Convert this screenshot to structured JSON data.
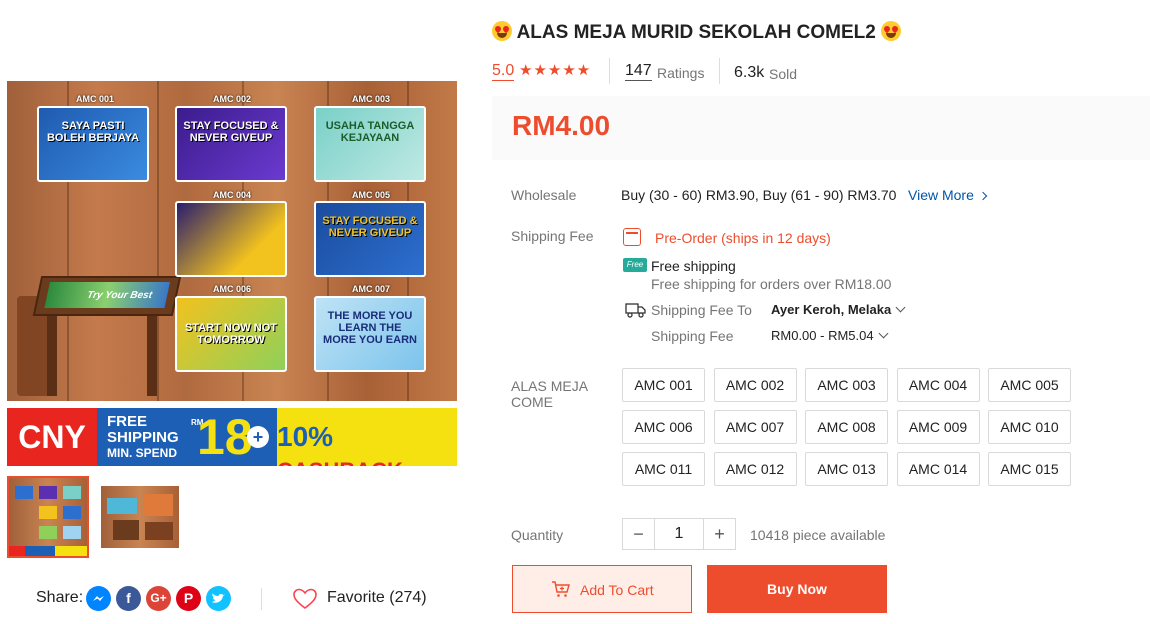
{
  "product": {
    "title": "ALAS MEJA MURID SEKOLAH COMEL2",
    "rating": "5.0",
    "stars": "★★★★★",
    "ratings_count": "147",
    "ratings_label": "Ratings",
    "sold_count": "6.3k",
    "sold_label": "Sold",
    "price": "RM4.00"
  },
  "gallery": {
    "mat_codes": [
      "AMC 001",
      "AMC 002",
      "AMC 003",
      "AMC 004",
      "AMC 005",
      "AMC 006",
      "AMC 007"
    ],
    "mat_texts": [
      "SAYA PASTI BOLEH BERJAYA",
      "STAY FOCUSED & NEVER GIVEUP",
      "USAHA TANGGA KEJAYAAN",
      "",
      "STAY FOCUSED & NEVER GIVEUP",
      "START NOW NOT TOMORROW",
      "THE MORE YOU LEARN THE MORE YOU EARN"
    ],
    "desk_mat_text": "Try Your Best",
    "banner": {
      "cny": "CNY",
      "free_line1": "FREE",
      "free_line2": "SHIPPING",
      "free_line3": "MIN. SPEND",
      "rm": "RM",
      "amount": "18",
      "plus": "+",
      "cashback_pct": "10%",
      "cashback": "CASHBACK"
    }
  },
  "share": {
    "label": "Share:",
    "favorite": "Favorite (274)"
  },
  "wholesale": {
    "label": "Wholesale",
    "text": "Buy (30 - 60) RM3.90, Buy (61 - 90) RM3.70",
    "view_more": "View More"
  },
  "shipping": {
    "label": "Shipping Fee",
    "preorder": "Pre-Order (ships in 12 days)",
    "free_badge": "Free",
    "free_title": "Free shipping",
    "free_sub": "Free shipping for orders over RM18.00",
    "to_label": "Shipping Fee To",
    "to_value": "Ayer Keroh, Melaka",
    "fee_label": "Shipping Fee",
    "fee_value": "RM0.00 - RM5.04"
  },
  "variation": {
    "label_line1": "ALAS MEJA",
    "label_line2": "COME",
    "options": [
      "AMC 001",
      "AMC 002",
      "AMC 003",
      "AMC 004",
      "AMC 005",
      "AMC 006",
      "AMC 007",
      "AMC 008",
      "AMC 009",
      "AMC 010",
      "AMC 011",
      "AMC 012",
      "AMC 013",
      "AMC 014",
      "AMC 015"
    ]
  },
  "quantity": {
    "label": "Quantity",
    "minus": "−",
    "value": "1",
    "plus": "+",
    "available": "10418 piece available"
  },
  "actions": {
    "add_to_cart": "Add To Cart",
    "buy_now": "Buy Now"
  },
  "colors": {
    "accent": "#ee4d2d"
  }
}
